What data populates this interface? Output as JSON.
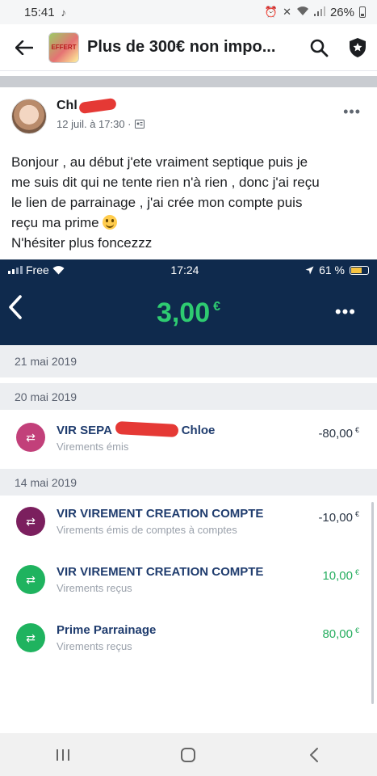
{
  "status_bar": {
    "time": "15:41",
    "battery": "26%"
  },
  "app_bar": {
    "title": "Plus de 300€ non impo...",
    "group_thumb_text": "EFFERT"
  },
  "post": {
    "author": "Chl",
    "timestamp": "12 juil. à 17:30 ·",
    "text_lines": [
      "Bonjour , au début j'ete vraiment septique puis je",
      "me suis dit qui ne tente rien n'à rien , donc j'ai reçu",
      "le lien de parrainage , j'ai crée mon compte puis",
      "reçu ma prime",
      "N'hésiter plus foncezzz"
    ]
  },
  "bank": {
    "carrier": "Free",
    "time": "17:24",
    "battery": "61 %",
    "balance": "3,00",
    "currency": "€",
    "dates": [
      "21 mai 2019",
      "20 mai 2019",
      "14 mai 2019"
    ],
    "transactions": [
      {
        "label_start": "VIR SEPA",
        "label_end": "Chloe",
        "category": "Virements émis",
        "amount": "-80,00",
        "currency": "€"
      },
      {
        "label": "VIR VIREMENT CREATION COMPTE",
        "category": "Virements émis de comptes à comptes",
        "amount": "-10,00",
        "currency": "€"
      },
      {
        "label": "VIR VIREMENT CREATION COMPTE",
        "category": "Virements reçus",
        "amount": "10,00",
        "currency": "€"
      },
      {
        "label": "Prime Parrainage",
        "category": "Virements reçus",
        "amount": "80,00",
        "currency": "€"
      }
    ]
  },
  "colors": {
    "bank_header": "#0f2a4d",
    "positive": "#27ae60",
    "balance_green": "#2ecc71",
    "icon_pink": "#c2407a",
    "icon_purple": "#7b1f5e",
    "icon_green": "#1fb35f"
  }
}
